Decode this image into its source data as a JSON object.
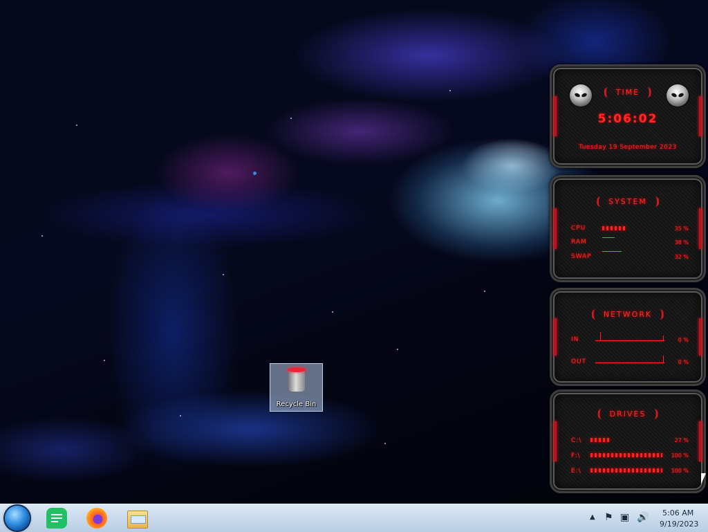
{
  "desktop": {
    "icons": [
      {
        "label": "Recycle Bin"
      }
    ]
  },
  "gadgets": {
    "time": {
      "title": "TIME",
      "clock": "5:06:02",
      "date": "Tuesday 19 September 2023"
    },
    "system": {
      "title": "SYSTEM",
      "rows": [
        {
          "label": "CPU",
          "value": "35 %",
          "level": 0.35
        },
        {
          "label": "RAM",
          "value": "38 %",
          "level": 0.38
        },
        {
          "label": "SWAP",
          "value": "32 %",
          "level": 0.32
        }
      ]
    },
    "network": {
      "title": "NETWORK",
      "rows": [
        {
          "label": "IN",
          "value": "0 %"
        },
        {
          "label": "OUT",
          "value": "0 %"
        }
      ]
    },
    "drives": {
      "title": "DRIVES",
      "rows": [
        {
          "label": "C:\\",
          "value": "27 %",
          "level": 0.27
        },
        {
          "label": "F:\\",
          "value": "100 %",
          "level": 1.0
        },
        {
          "label": "E:\\",
          "value": "100 %",
          "level": 1.0
        }
      ]
    }
  },
  "taskbar": {
    "apps": [
      {
        "icon": "start-orb-icon"
      },
      {
        "icon": "notes-app-icon"
      },
      {
        "icon": "firefox-icon"
      },
      {
        "icon": "file-explorer-icon"
      }
    ],
    "tray": {
      "time": "5:06 AM",
      "date": "9/19/2023"
    }
  },
  "colors": {
    "gadget_red": "#ff2626",
    "line_green": "#25c73a",
    "taskbar": "#c9dbee"
  }
}
